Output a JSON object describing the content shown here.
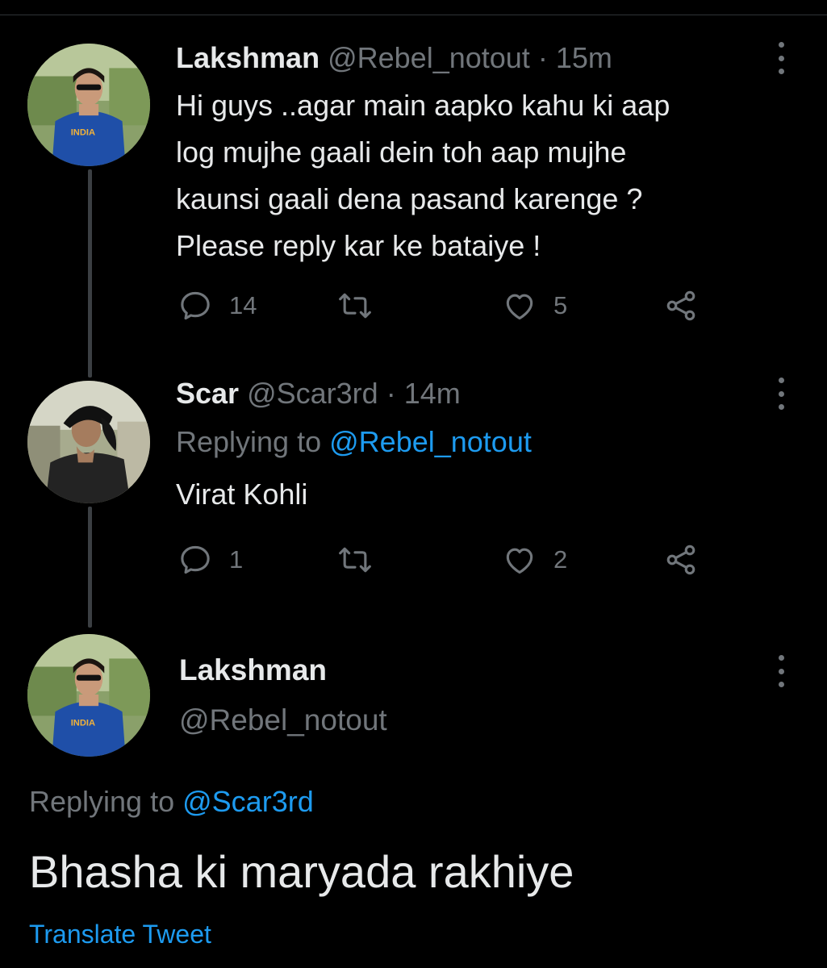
{
  "tweets": [
    {
      "name": "Lakshman",
      "handle": "@Rebel_notout",
      "separator": "·",
      "time": "15m",
      "lines": [
        "Hi guys ..agar main aapko kahu ki aap",
        "log mujhe gaali dein toh aap mujhe",
        "kaunsi gaali dena pasand karenge ?",
        "Please reply kar ke bataiye !"
      ],
      "reply_count": "14",
      "like_count": "5"
    },
    {
      "name": "Scar",
      "handle": "@Scar3rd",
      "separator": "·",
      "time": "14m",
      "replying_label": "Replying to",
      "replying_to": "@Rebel_notout",
      "text": "Virat Kohli",
      "reply_count": "1",
      "like_count": "2"
    }
  ],
  "focused_tweet": {
    "name": "Lakshman",
    "handle": "@Rebel_notout",
    "replying_label": "Replying to",
    "replying_to": "@Scar3rd",
    "text": "Bhasha ki maryada rakhiye",
    "translate_label": "Translate Tweet"
  },
  "icons": [
    "reply-icon",
    "retweet-icon",
    "like-icon",
    "share-icon",
    "more-options-icon"
  ],
  "colors": {
    "background": "#000000",
    "text": "#e7e9ea",
    "muted": "#71767b",
    "link": "#1d9bf0",
    "thread": "#3b3f43"
  },
  "avatar_jersey_text": "INDIA"
}
